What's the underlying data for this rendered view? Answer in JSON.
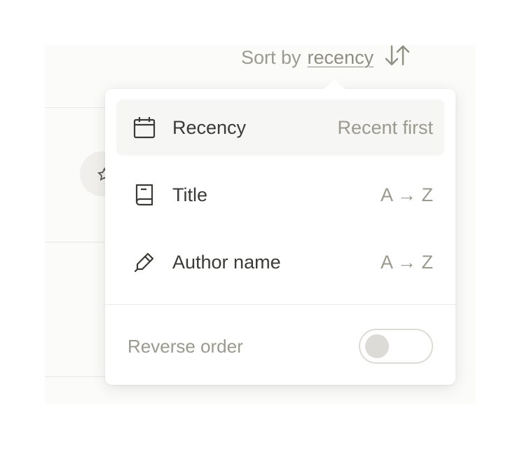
{
  "sort": {
    "prefix": "Sort by",
    "value": "recency"
  },
  "menu": {
    "options": [
      {
        "label": "Recency",
        "hint": "Recent first",
        "icon": "calendar-icon",
        "selected": true
      },
      {
        "label": "Title",
        "hint": "A → Z",
        "icon": "book-icon",
        "selected": false
      },
      {
        "label": "Author name",
        "hint": "A → Z",
        "icon": "pen-icon",
        "selected": false
      }
    ],
    "reverse": {
      "label": "Reverse order",
      "on": false
    }
  },
  "colors": {
    "text": "#3a3a36",
    "muted": "#9b9a8f",
    "selected_bg": "#f6f6f5"
  }
}
